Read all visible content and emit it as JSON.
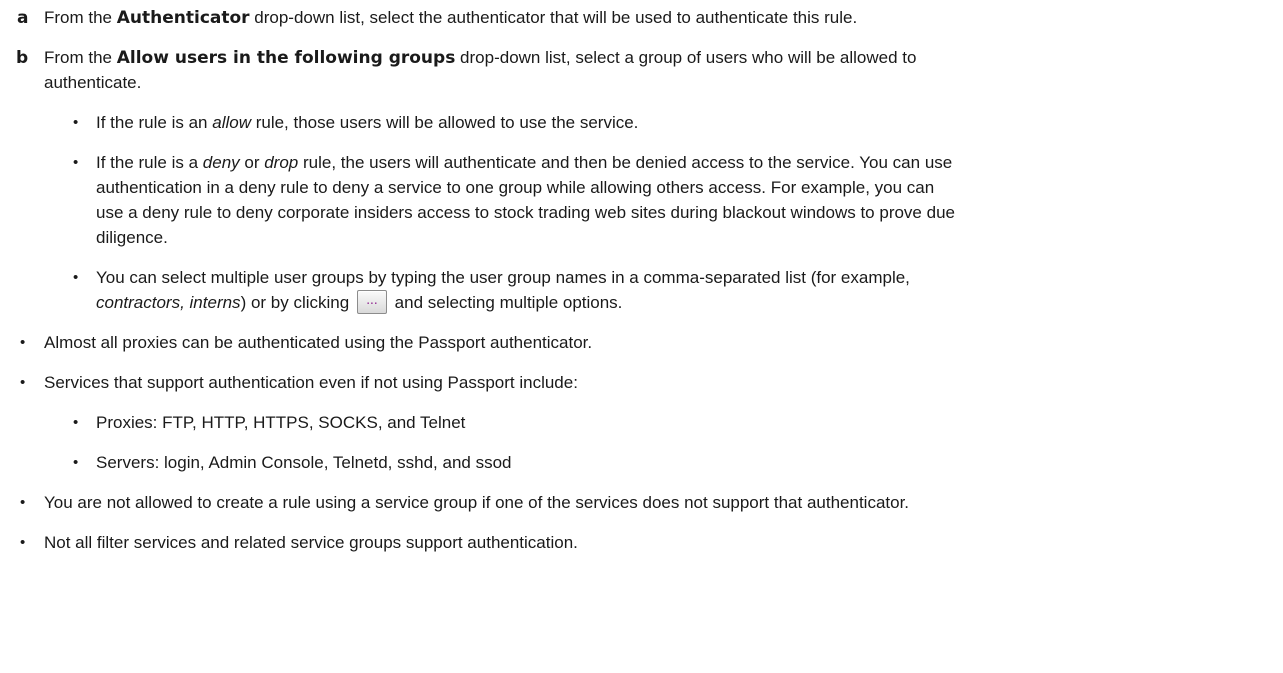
{
  "steps": [
    {
      "letter": "a",
      "parts": [
        "From the ",
        "Authenticator",
        " drop-down list, select the authenticator that will be used to authenticate this rule."
      ]
    },
    {
      "letter": "b",
      "parts": [
        "From the ",
        "Allow users in the following groups",
        " drop-down list, select a group of users who will be allowed to"
      ],
      "line2": "authenticate.",
      "sub_bullets": [
        {
          "parts": [
            "If the rule is an ",
            "allow",
            " rule, those users will be allowed to use the service."
          ]
        },
        {
          "line1_parts": [
            "If the rule is a ",
            "deny",
            " or ",
            "drop",
            " rule, the users will authenticate and then be denied access to the service. You can use"
          ],
          "line2": "authentication in a deny rule to deny a service to one group while allowing others access. For example, you can",
          "line3": "use a deny rule to deny corporate insiders access to stock trading web sites during blackout windows to prove due",
          "line4": "diligence."
        },
        {
          "line1": "You can select multiple user groups by typing the user group names in a comma-separated list (for example,",
          "line2_parts": [
            "contractors, interns",
            ") or by clicking ",
            " and selecting multiple options."
          ],
          "button_label": "..."
        }
      ]
    }
  ],
  "notes": [
    "Almost all proxies can be authenticated using the Passport authenticator.",
    "Services that support authentication even if not using Passport include:",
    "You are not allowed to create a rule using a service group if one of the services does not support that authenticator.",
    "Not all filter services and related service groups support authentication."
  ],
  "note_sub_bullets": [
    "Proxies: FTP, HTTP, HTTPS, SOCKS, and Telnet",
    "Servers: login, Admin Console, Telnetd, sshd, and ssod"
  ],
  "bullet_char": "•"
}
